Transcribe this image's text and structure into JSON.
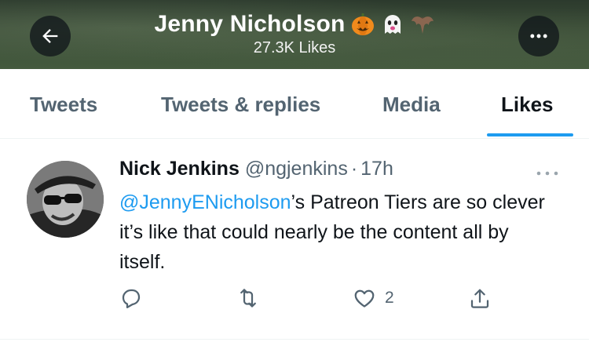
{
  "header": {
    "name": "Jenny Nicholson",
    "emojis": [
      "jack-o-lantern-icon",
      "ghost-icon",
      "bat-icon"
    ],
    "likes_count": "27.3K Likes",
    "back_icon": "arrow-left-icon",
    "more_icon": "more-horizontal-icon"
  },
  "tabs": [
    {
      "label": "Tweets",
      "active": false
    },
    {
      "label": "Tweets & replies",
      "active": false
    },
    {
      "label": "Media",
      "active": false
    },
    {
      "label": "Likes",
      "active": true
    }
  ],
  "tweet": {
    "author": "Nick Jenkins",
    "handle": "@ngjenkins",
    "separator": "·",
    "time": "17h",
    "mention": "@JennyENicholson",
    "body_rest": "’s Patreon Tiers are so clever it’s like that could nearly be the content all by itself.",
    "actions": {
      "reply_icon": "reply-icon",
      "retweet_icon": "retweet-icon",
      "like_icon": "heart-icon",
      "like_count": "2",
      "share_icon": "share-icon"
    }
  },
  "colors": {
    "accent": "#1d9bf0",
    "text": "#0f1419",
    "muted": "#536471"
  }
}
